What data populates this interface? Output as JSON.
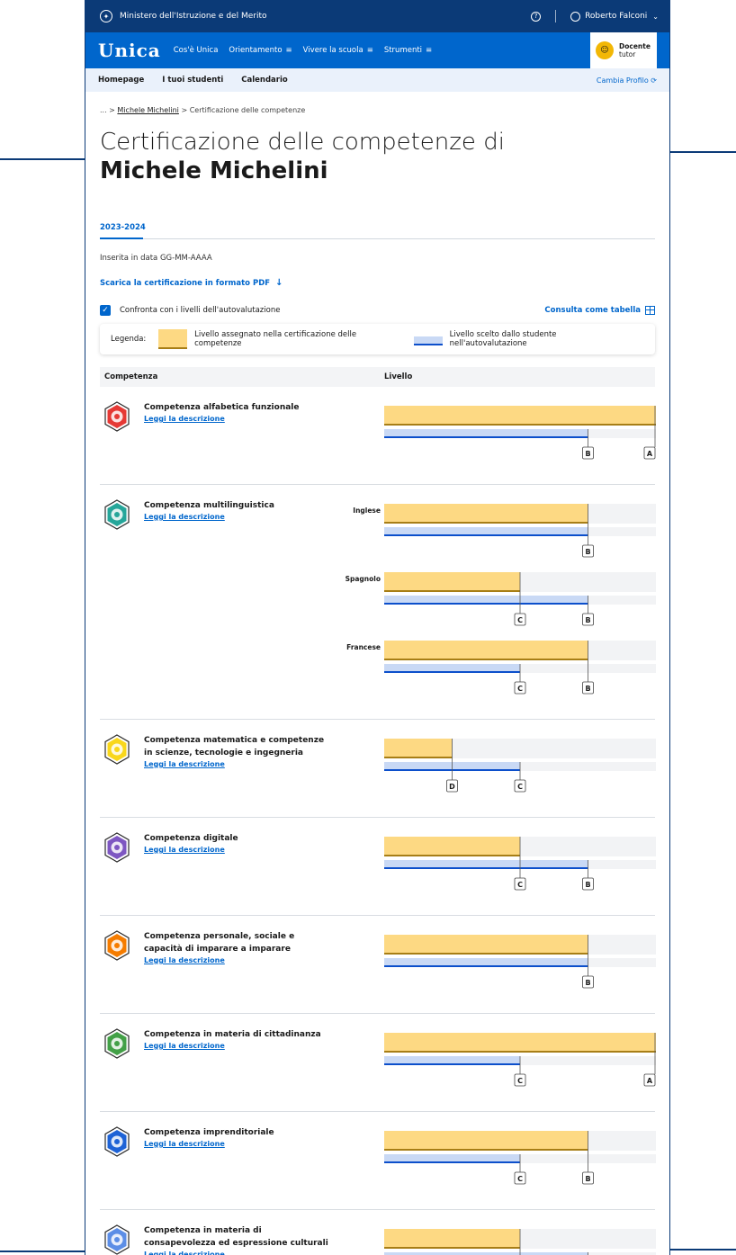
{
  "ministry_bar": {
    "title": "Ministero dell'Istruzione e del Merito",
    "user_name": "Roberto Falconi"
  },
  "main_nav": {
    "logo": "Unica",
    "items": [
      "Cos'è Unica",
      "Orientamento",
      "Vivere la scuola",
      "Strumenti"
    ],
    "profile_role": "Docente",
    "profile_sub": "tutor"
  },
  "sub_nav": {
    "tabs": [
      "Homepage",
      "I tuoi studenti",
      "Calendario"
    ],
    "switch_profile": "Cambia Profilo"
  },
  "breadcrumb": {
    "prefix": "... >",
    "student": "Michele Michelini",
    "sep": ">",
    "current": "Certificazione delle competenze"
  },
  "page": {
    "title": "Certificazione delle competenze di",
    "student_name": "Michele Michelini",
    "year_tab": "2023-2024",
    "inserted": "Inserita in data GG-MM-AAAA",
    "download": "Scarica la certificazione in formato PDF",
    "compare_label": "Confronta con i livelli dell'autovalutazione",
    "table_link": "Consulta come tabella"
  },
  "legend": {
    "label": "Legenda:",
    "assigned": "Livello assegnato nella certificazione delle competenze",
    "self": "Livello scelto dallo studente nell'autovalutazione"
  },
  "table_header": {
    "competenza": "Competenza",
    "livello": "Livello"
  },
  "colors": {
    "assigned_fill": "#fdd983",
    "assigned_line": "#a77e16",
    "self_fill": "#c9d9f5",
    "self_line": "#0c4fcb",
    "track": "#f2f3f5",
    "primary": "#0066cc",
    "header_dark": "#0b3a77"
  },
  "link_label": "Leggi la descrizione",
  "chart_data": {
    "type": "bar",
    "level_scale": [
      "D",
      "C",
      "B",
      "A"
    ],
    "competences": [
      {
        "name": [
          "Competenza alfabetica funzionale"
        ],
        "icon": "lightbulb-icon",
        "color": "#e53935",
        "bars": [
          {
            "label": "",
            "assigned": "A",
            "self": "B"
          }
        ]
      },
      {
        "name": [
          "Competenza multilinguistica"
        ],
        "icon": "language-icon",
        "color": "#26a69a",
        "bars": [
          {
            "label": "Inglese",
            "assigned": "B",
            "self": "B"
          },
          {
            "label": "Spagnolo",
            "assigned": "C",
            "self": "B"
          },
          {
            "label": "Francese",
            "assigned": "B",
            "self": "C"
          }
        ]
      },
      {
        "name": [
          "Competenza matematica e competenze",
          "in scienze, tecnologie e ingegneria"
        ],
        "icon": "atom-icon",
        "color": "#f9d71c",
        "bars": [
          {
            "label": "",
            "assigned": "D",
            "self": "C"
          }
        ]
      },
      {
        "name": [
          "Competenza digitale"
        ],
        "icon": "computer-icon",
        "color": "#7e57c2",
        "bars": [
          {
            "label": "",
            "assigned": "C",
            "self": "B"
          }
        ]
      },
      {
        "name": [
          "Competenza personale, sociale e",
          "capacità di imparare a imparare"
        ],
        "icon": "graduation-icon",
        "color": "#f57c00",
        "bars": [
          {
            "label": "",
            "assigned": "B",
            "self": "B"
          }
        ]
      },
      {
        "name": [
          "Competenza in materia di cittadinanza"
        ],
        "icon": "medal-icon",
        "color": "#43a047",
        "bars": [
          {
            "label": "",
            "assigned": "A",
            "self": "C"
          }
        ]
      },
      {
        "name": [
          "Competenza imprenditoriale"
        ],
        "icon": "rocket-icon",
        "color": "#1e63d6",
        "bars": [
          {
            "label": "",
            "assigned": "B",
            "self": "C"
          }
        ]
      },
      {
        "name": [
          "Competenza in materia di",
          "consapevolezza ed espressione culturali"
        ],
        "icon": "theater-icon",
        "color": "#5c8ee6",
        "bars": [
          {
            "label": "",
            "assigned": "C",
            "self": "B"
          }
        ]
      }
    ]
  }
}
